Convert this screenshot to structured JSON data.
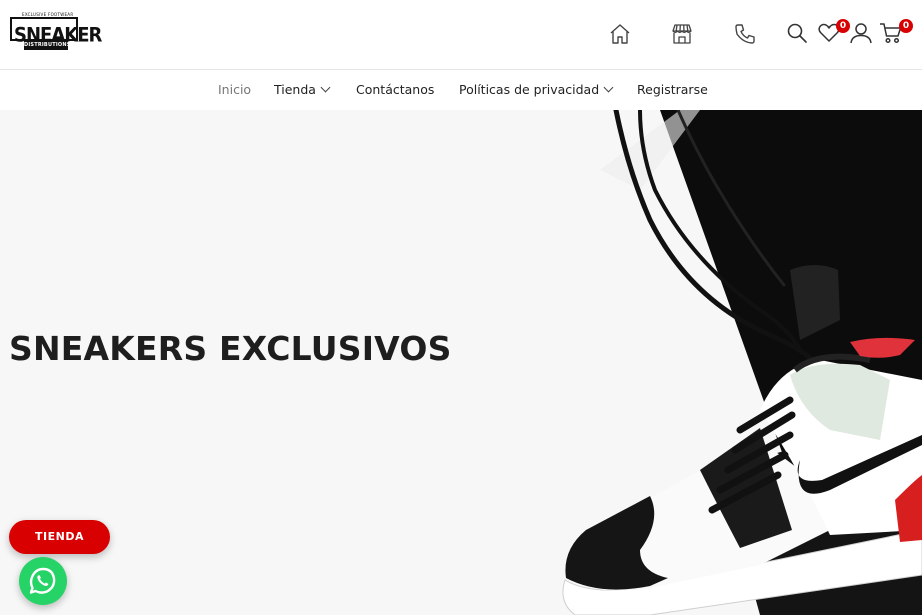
{
  "brand": {
    "logo_tagline": "EXCLUSIVE FOOTWEAR",
    "logo_main": "SNEAKER",
    "logo_sub": "DISTRIBUTIONS"
  },
  "header_icons": {
    "home": "home-icon",
    "store": "store-icon",
    "phone": "phone-icon",
    "search": "search-icon",
    "wishlist": "heart-icon",
    "account": "user-icon",
    "cart": "cart-icon"
  },
  "wishlist_count": "0",
  "cart_count": "0",
  "nav": {
    "items": [
      {
        "label": "Inicio",
        "active": true,
        "dropdown": false
      },
      {
        "label": "Tienda",
        "active": false,
        "dropdown": true
      },
      {
        "label": "Contáctanos",
        "active": false,
        "dropdown": false
      },
      {
        "label": "Políticas de privacidad",
        "active": false,
        "dropdown": true
      },
      {
        "label": "Registrarse",
        "active": false,
        "dropdown": false
      }
    ]
  },
  "hero": {
    "title": "SNEAKERS EXCLUSIVOS"
  },
  "floating": {
    "shop_button": "TIENDA",
    "chat_icon": "whatsapp-icon"
  },
  "colors": {
    "accent": "#d80000",
    "whatsapp": "#25d366",
    "text": "#1e1e1e"
  }
}
